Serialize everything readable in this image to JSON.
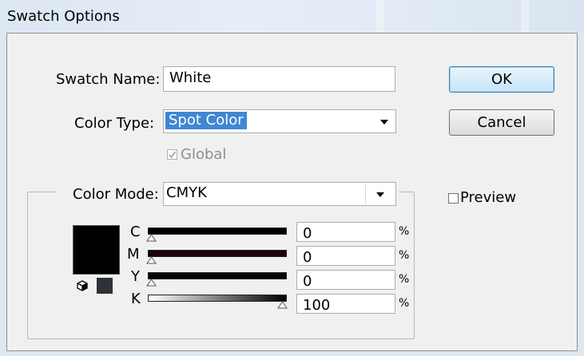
{
  "window": {
    "title": "Swatch Options"
  },
  "swatch_name": {
    "label": "Swatch Name:",
    "value": "White"
  },
  "color_type": {
    "label": "Color Type:",
    "value": "Spot Color"
  },
  "global": {
    "label": "Global",
    "checked": true,
    "enabled": false
  },
  "color_mode": {
    "label": "Color Mode:",
    "value": "CMYK"
  },
  "buttons": {
    "ok": "OK",
    "cancel": "Cancel"
  },
  "preview": {
    "label": "Preview",
    "checked": false
  },
  "channels": [
    {
      "letter": "C",
      "value": "0",
      "unit": "%"
    },
    {
      "letter": "M",
      "value": "0",
      "unit": "%"
    },
    {
      "letter": "Y",
      "value": "0",
      "unit": "%"
    },
    {
      "letter": "K",
      "value": "100",
      "unit": "%"
    }
  ],
  "colors": {
    "swatch": "#000000",
    "selection": "#3f86d4"
  }
}
